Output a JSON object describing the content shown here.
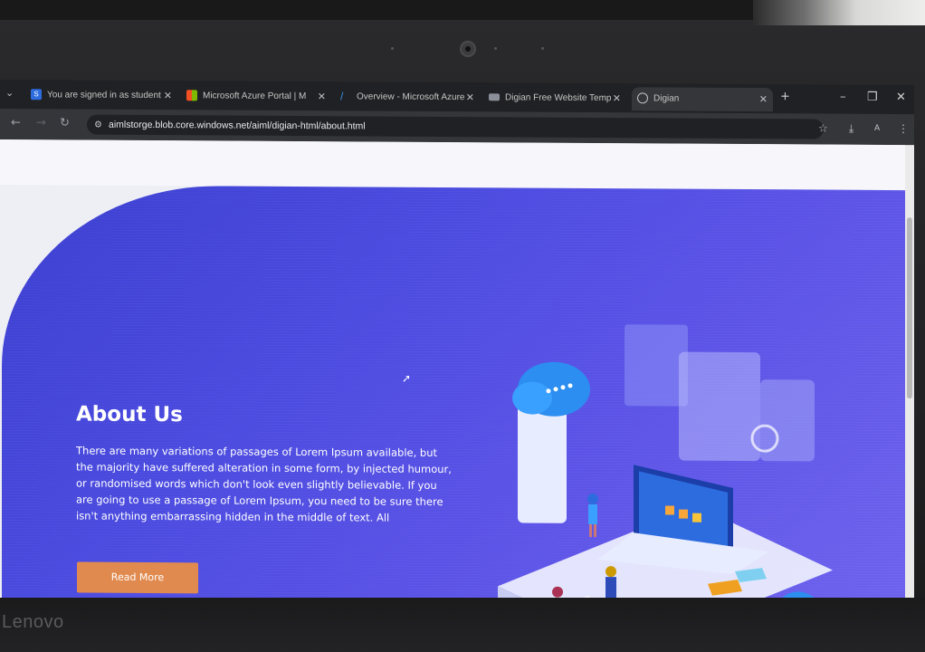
{
  "browser": {
    "tabs": [
      {
        "label": "You are signed in as student",
        "icon": "sign-in-status-icon"
      },
      {
        "label": "Microsoft Azure Portal | M",
        "icon": "microsoft-logo-icon"
      },
      {
        "label": "Overview - Microsoft Azure",
        "icon": "azure-logo-icon"
      },
      {
        "label": "Digian Free Website Temp",
        "icon": "page-icon"
      },
      {
        "label": "Digian",
        "icon": "globe-icon",
        "active": true
      }
    ],
    "address": {
      "url": "aimlstorge.blob.core.windows.net/aiml/digian-html/about.html"
    }
  },
  "page": {
    "hero": {
      "title": "About Us",
      "text": "There are many variations of passages of Lorem Ipsum available, but the majority have suffered alteration in some form, by injected humour, or randomised words which don't look even slightly believable. If you are going to use a passage of Lorem Ipsum, you need to be sure there isn't anything embarrassing hidden in the middle of text. All",
      "button_label": "Read More"
    },
    "colors": {
      "hero_start": "#3b3fcf",
      "hero_end": "#6e63ee",
      "button": "#e08a4f"
    }
  },
  "device": {
    "brand": "Lenovo"
  }
}
